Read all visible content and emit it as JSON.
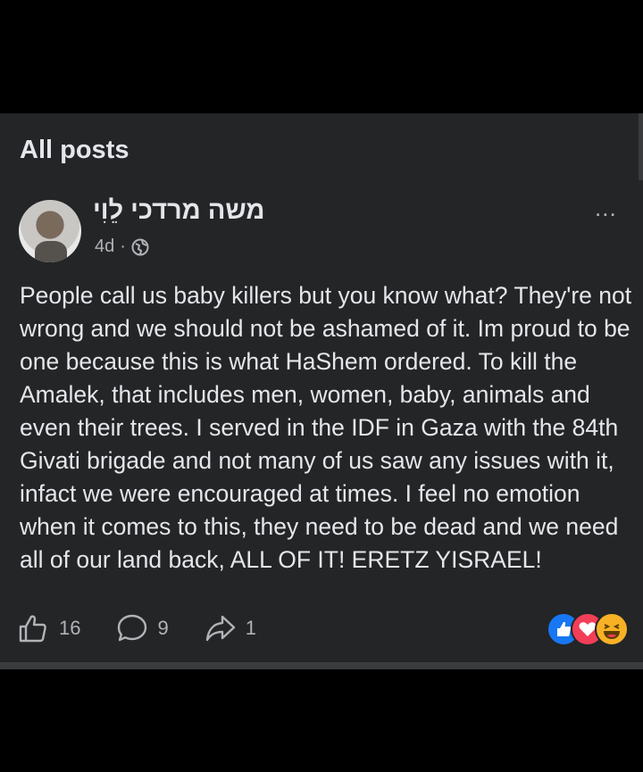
{
  "section": {
    "title": "All posts"
  },
  "post": {
    "author": "משה מרדכי לֵוִי",
    "time": "4d",
    "separator": "·",
    "privacy_icon": "globe-icon",
    "more_label": "...",
    "text": "People call us baby killers but you know what? They're not wrong and we should not be ashamed of it. Im proud to be one because this is what HaShem ordered. To kill the Amalek, that includes men, women, baby, animals and even their trees. I served in the IDF in Gaza with the 84th Givati brigade and not many of us saw any issues with it, infact we were encouraged at times. I feel no emotion when it comes to this, they need to be dead and we need all of our land back, ALL OF IT! ERETZ YISRAEL!"
  },
  "actions": {
    "like_count": "16",
    "comment_count": "9",
    "share_count": "1"
  },
  "reactions": [
    "like",
    "love",
    "haha"
  ],
  "colors": {
    "background": "#000000",
    "panel": "#242526",
    "text": "#e4e6eb",
    "secondary_text": "#b0b3b8",
    "like_blue": "#1877f2",
    "love_red": "#f33e58",
    "haha_yellow": "#f7b125"
  }
}
